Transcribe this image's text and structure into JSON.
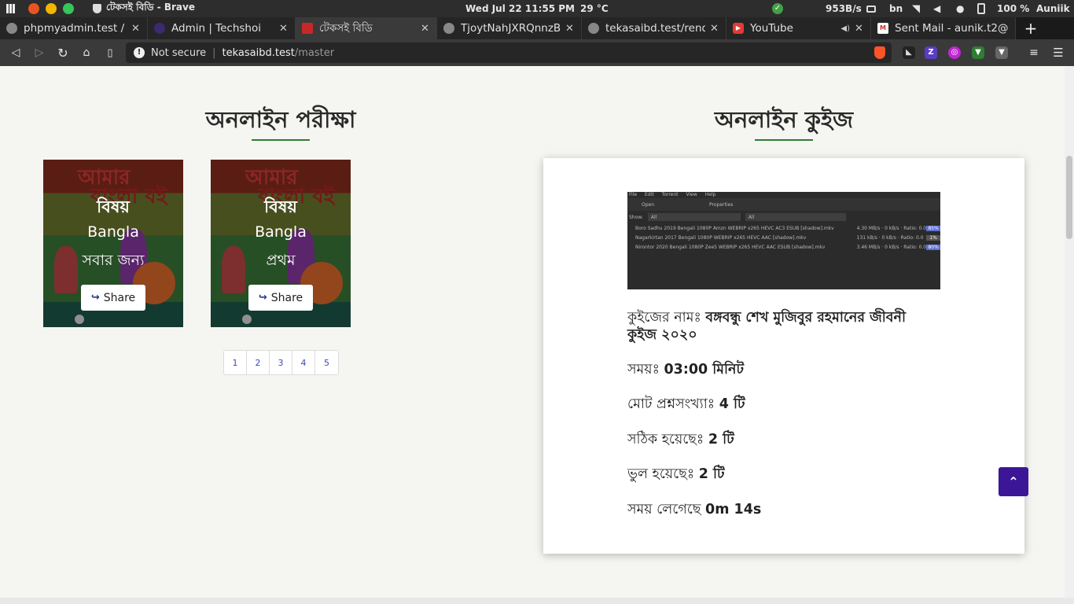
{
  "os_bar": {
    "window_title": "টেকসই বিডি - Brave",
    "clock": "Wed Jul 22  11:55 PM",
    "temperature": "29 °C",
    "net_speed": "953B/s",
    "keyboard_lang": "bn",
    "battery": "100 %",
    "user": "Auniik"
  },
  "tabs": [
    {
      "title": "phpmyadmin.test / lo",
      "icon": "globe-icon",
      "active": false
    },
    {
      "title": "Admin | Techshoi",
      "icon": "slash-icon",
      "active": false
    },
    {
      "title": "টেকসই বিডি",
      "icon": "site-logo-icon",
      "active": true
    },
    {
      "title": "TjoytNahJXRQnnzBL",
      "icon": "globe-icon",
      "active": false
    },
    {
      "title": "tekasaibd.test/rende",
      "icon": "globe-icon",
      "active": false
    },
    {
      "title": "YouTube",
      "icon": "youtube-icon",
      "active": false
    },
    {
      "title": "Sent Mail - aunik.t2@",
      "icon": "gmail-icon",
      "active": false
    }
  ],
  "address_bar": {
    "security_label": "Not secure",
    "url_host": "tekasaibd.test",
    "url_path": "/master"
  },
  "exam_section": {
    "title": "অনলাইন পরীক্ষা",
    "cards": [
      {
        "cover_title_1": "আমার",
        "cover_title_2": "বাংলা বই",
        "heading": "বিষয়",
        "subject": "Bangla",
        "audience": "সবার জন্য",
        "share_label": "Share"
      },
      {
        "cover_title_1": "আমার",
        "cover_title_2": "বাংলা বই",
        "heading": "বিষয়",
        "subject": "Bangla",
        "audience": "প্রথম",
        "share_label": "Share"
      }
    ],
    "pages": [
      "1",
      "2",
      "3",
      "4",
      "5"
    ]
  },
  "quiz_section": {
    "title": "অনলাইন কুইজ",
    "screenshot": {
      "menu": [
        "File",
        "Edit",
        "Torrent",
        "View",
        "Help"
      ],
      "toolbar": [
        "Open",
        "Properties"
      ],
      "filter_label": "Show:",
      "filter_values": [
        "All",
        "All"
      ],
      "rows": [
        {
          "name": "Boro Sadhu 2019 Bengali 1080P Amzn WEBRIP x265 HEVC AC3 ESUB [shadow].mkv",
          "rate": "4.30 MB/s · 0 kB/s · Ratio: 0.0",
          "pct": "85%"
        },
        {
          "name": "Nagarkirtan 2017 Bengali 1080P WEBRIP x265 HEVC AAC [shadow].mkv",
          "rate": "131 kB/s · 0 kB/s · Ratio: 0.0",
          "pct": "1%"
        },
        {
          "name": "Nirontor 2020 Bengali 1080P Zee5 WEBRIP x265 HEVC AAC ESUB [shadow].mkv",
          "rate": "3.46 MB/s · 0 kB/s · Ratio: 0.0",
          "pct": "80%"
        }
      ]
    },
    "name_label": "কুইজের নামঃ",
    "name_value": "বঙ্গবন্ধু শেখ মুজিবুর রহমানের জীবনী",
    "name_value_2": "কুইজ ২০২০",
    "time_label": "সময়ঃ",
    "time_value": "03:00 মিনিট",
    "total_label": "মোট প্রশ্নসংখ্যাঃ",
    "total_value": "4 টি",
    "correct_label": "সঠিক হয়েছেঃ",
    "correct_value": "2 টি",
    "wrong_label": "ভুল হয়েছেঃ",
    "wrong_value": "2 টি",
    "spent_label": "সময় লেগেছে",
    "spent_value": "0m 14s"
  },
  "colors": {
    "accent_line": "#2e7d32",
    "to_top_button": "#3b1797",
    "pager_text": "#3a49b8"
  }
}
